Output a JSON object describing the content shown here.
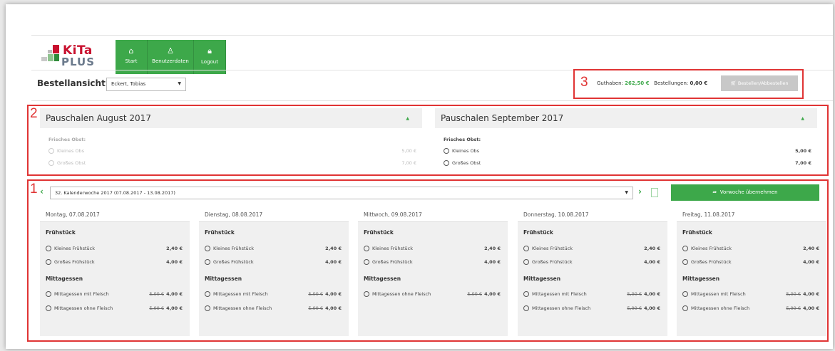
{
  "app": {
    "logo_top": "KiTa",
    "logo_bottom": "PLUS"
  },
  "nav": [
    {
      "label": "Start",
      "icon": "home-icon"
    },
    {
      "label": "Benutzerdaten",
      "icon": "user-icon"
    },
    {
      "label": "Logout",
      "icon": "lock-icon"
    }
  ],
  "page": {
    "title": "Bestellansicht",
    "user": "Eckert, Tobias"
  },
  "markers": {
    "one": "1",
    "two": "2",
    "three": "3"
  },
  "balance": {
    "guthaben_label": "Guthaben:",
    "guthaben_value": "262,50 €",
    "bestellungen_label": "Bestellungen:",
    "bestellungen_value": "0,00 €",
    "order_button": "Bestellen/Abbestellen"
  },
  "pauschalen": [
    {
      "title": "Pauschalen August 2017",
      "section": "Frisches Obst:",
      "items": [
        {
          "label": "Kleines Obs",
          "price": "5,00 €"
        },
        {
          "label": "Großes Obst",
          "price": "7,00 €"
        }
      ]
    },
    {
      "title": "Pauschalen September 2017",
      "section": "Frisches Obst:",
      "items": [
        {
          "label": "Kleines Obs",
          "price": "5,00 €"
        },
        {
          "label": "Großes Obst",
          "price": "7,00 €"
        }
      ]
    }
  ],
  "week": {
    "label": "32. Kalenderwoche 2017  (07.08.2017 - 13.08.2017)",
    "prev_week_button": "Vorwoche übernehmen"
  },
  "days": [
    {
      "date": "Montag, 07.08.2017",
      "breakfast_title": "Frühstück",
      "breakfast": [
        {
          "label": "Kleines Frühstück",
          "price": "2,40 €"
        },
        {
          "label": "Großes Frühstück",
          "price": "4,00 €"
        }
      ],
      "lunch_title": "Mittagessen",
      "lunch": [
        {
          "label": "Mittagessen mit Fleisch",
          "old": "5,00 €",
          "price": "4,00 €"
        },
        {
          "label": "Mittagessen ohne Fleisch",
          "old": "5,00 €",
          "price": "4,00 €"
        }
      ]
    },
    {
      "date": "Dienstag, 08.08.2017",
      "breakfast_title": "Frühstück",
      "breakfast": [
        {
          "label": "Kleines Frühstück",
          "price": "2,40 €"
        },
        {
          "label": "Großes Frühstück",
          "price": "4,00 €"
        }
      ],
      "lunch_title": "Mittagessen",
      "lunch": [
        {
          "label": "Mittagessen mit Fleisch",
          "old": "5,00 €",
          "price": "4,00 €"
        },
        {
          "label": "Mittagessen ohne Fleisch",
          "old": "5,00 €",
          "price": "4,00 €"
        }
      ]
    },
    {
      "date": "Mittwoch, 09.08.2017",
      "breakfast_title": "Frühstück",
      "breakfast": [
        {
          "label": "Kleines Frühstück",
          "price": "2,40 €"
        },
        {
          "label": "Großes Frühstück",
          "price": "4,00 €"
        }
      ],
      "lunch_title": "Mittagessen",
      "lunch": [
        {
          "label": "Mittagessen ohne Fleisch",
          "old": "5,00 €",
          "price": "4,00 €"
        }
      ]
    },
    {
      "date": "Donnerstag, 10.08.2017",
      "breakfast_title": "Frühstück",
      "breakfast": [
        {
          "label": "Kleines Frühstück",
          "price": "2,40 €"
        },
        {
          "label": "Großes Frühstück",
          "price": "4,00 €"
        }
      ],
      "lunch_title": "Mittagessen",
      "lunch": [
        {
          "label": "Mittagessen mit Fleisch",
          "old": "5,00 €",
          "price": "4,00 €"
        },
        {
          "label": "Mittagessen ohne Fleisch",
          "old": "5,00 €",
          "price": "4,00 €"
        }
      ]
    },
    {
      "date": "Freitag, 11.08.2017",
      "breakfast_title": "Frühstück",
      "breakfast": [
        {
          "label": "Kleines Frühstück",
          "price": "2,40 €"
        },
        {
          "label": "Großes Frühstück",
          "price": "4,00 €"
        }
      ],
      "lunch_title": "Mittagessen",
      "lunch": [
        {
          "label": "Mittagessen mit Fleisch",
          "old": "5,00 €",
          "price": "4,00 €"
        },
        {
          "label": "Mittagessen ohne Fleisch",
          "old": "5,00 €",
          "price": "4,00 €"
        }
      ]
    }
  ],
  "colors": {
    "accent": "#3da84a",
    "highlight": "#e03434",
    "panel": "#f0f0f0"
  }
}
